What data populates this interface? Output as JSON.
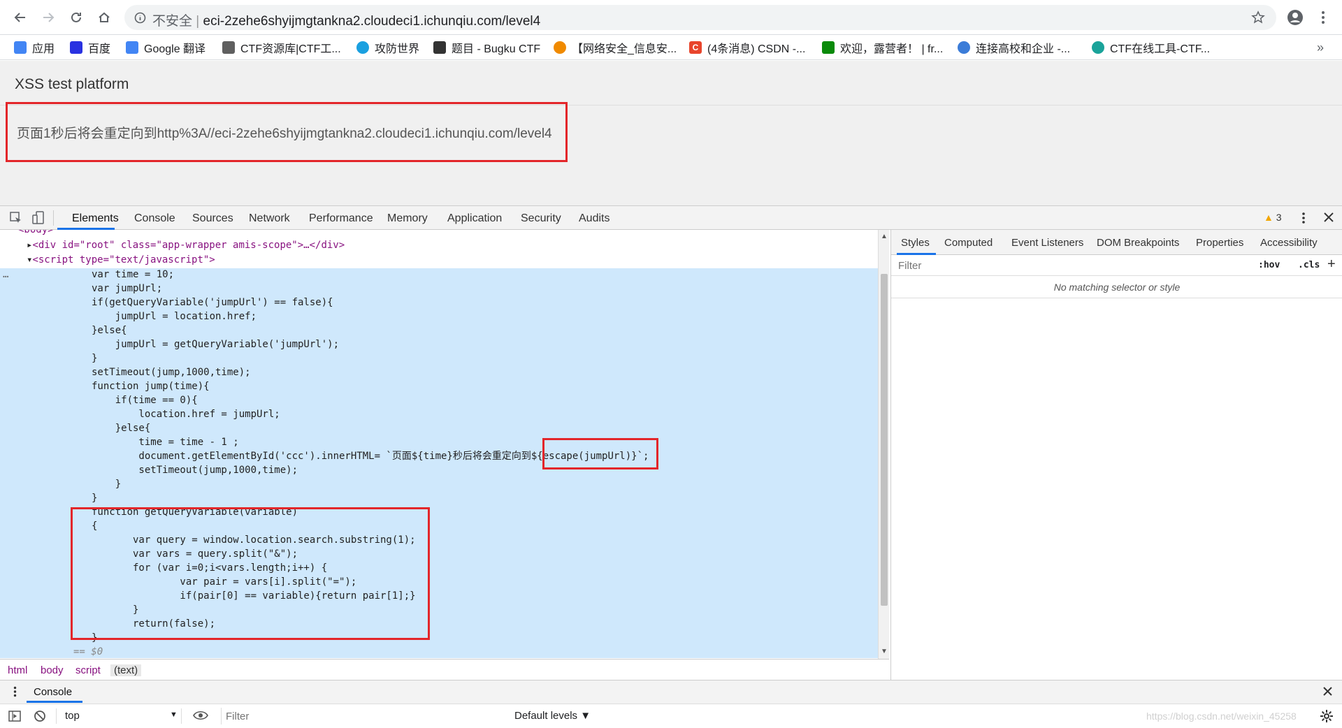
{
  "browser": {
    "insecure_label": "不安全",
    "url": "eci-2zehe6shyijmgtankna2.cloudeci1.ichunqiu.com/level4"
  },
  "bookmarks": [
    {
      "label": "应用",
      "icon": "apps-grid-icon",
      "color": "#4285f4"
    },
    {
      "label": "百度",
      "icon": "baidu-paw-icon",
      "color": "#2932e1"
    },
    {
      "label": "Google 翻译",
      "icon": "google-translate-icon",
      "color": "#4285f4"
    },
    {
      "label": "CTF资源库|CTF工...",
      "icon": "hacker-icon",
      "color": "#5f5f5f"
    },
    {
      "label": "攻防世界",
      "icon": "swirl-icon",
      "color": "#1aa0e0"
    },
    {
      "label": "题目 - Bugku CTF",
      "icon": "flag-icon",
      "color": "#333333"
    },
    {
      "label": "【网络安全_信息安...",
      "icon": "orange-logo-icon",
      "color": "#f08a00"
    },
    {
      "label": "(4条消息) CSDN -...",
      "icon": "csdn-icon",
      "color": "#e8452c"
    },
    {
      "label": "欢迎，露营者！ | fr...",
      "icon": "freecodecamp-icon",
      "color": "#0a8a0a"
    },
    {
      "label": "连接高校和企业 -...",
      "icon": "cloud-icon",
      "color": "#3b7cd8"
    },
    {
      "label": "CTF在线工具-CTF...",
      "icon": "ctf-tool-icon",
      "color": "#1aa39a"
    }
  ],
  "page": {
    "title": "XSS test platform",
    "redirect_message": "页面1秒后将会重定向到http%3A//eci-2zehe6shyijmgtankna2.cloudeci1.ichunqiu.com/level4"
  },
  "devtools": {
    "tabs": [
      "Elements",
      "Console",
      "Sources",
      "Network",
      "Performance",
      "Memory",
      "Application",
      "Security",
      "Audits"
    ],
    "active_tab": "Elements",
    "warning_count": "3",
    "code_lines": [
      "<body>",
      "<div id=\"root\" class=\"app-wrapper amis-scope\">…</div>",
      "<script type=\"text/javascript\">",
      "var time = 10;",
      "var jumpUrl;",
      "if(getQueryVariable('jumpUrl') == false){",
      "    jumpUrl = location.href;",
      "}else{",
      "    jumpUrl = getQueryVariable('jumpUrl');",
      "}",
      "setTimeout(jump,1000,time);",
      "function jump(time){",
      "    if(time == 0){",
      "        location.href = jumpUrl;",
      "    }else{",
      "        time = time - 1 ;",
      "        document.getElementById('ccc').innerHTML= `页面${time}秒后将会重定向到${escape(jumpUrl)}`;",
      "        setTimeout(jump,1000,time);",
      "    }",
      "}",
      "function getQueryVariable(variable)",
      "{",
      "       var query = window.location.search.substring(1);",
      "       var vars = query.split(\"&\");",
      "       for (var i=0;i<vars.length;i++) {",
      "               var pair = vars[i].split(\"=\");",
      "               if(pair[0] == variable){return pair[1];}",
      "       }",
      "       return(false);",
      "}",
      "== $0"
    ],
    "breadcrumbs": [
      "html",
      "body",
      "script",
      "(text)"
    ],
    "styles_tabs": [
      "Styles",
      "Computed",
      "Event Listeners",
      "DOM Breakpoints",
      "Properties",
      "Accessibility"
    ],
    "styles_filter_placeholder": "Filter",
    "hov_label": ":hov",
    "cls_label": ".cls",
    "no_match": "No matching selector or style",
    "drawer_tab": "Console",
    "context": "top",
    "console_filter_placeholder": "Filter",
    "levels": "Default levels ▼",
    "watermark": "https://blog.csdn.net/weixin_45258"
  }
}
